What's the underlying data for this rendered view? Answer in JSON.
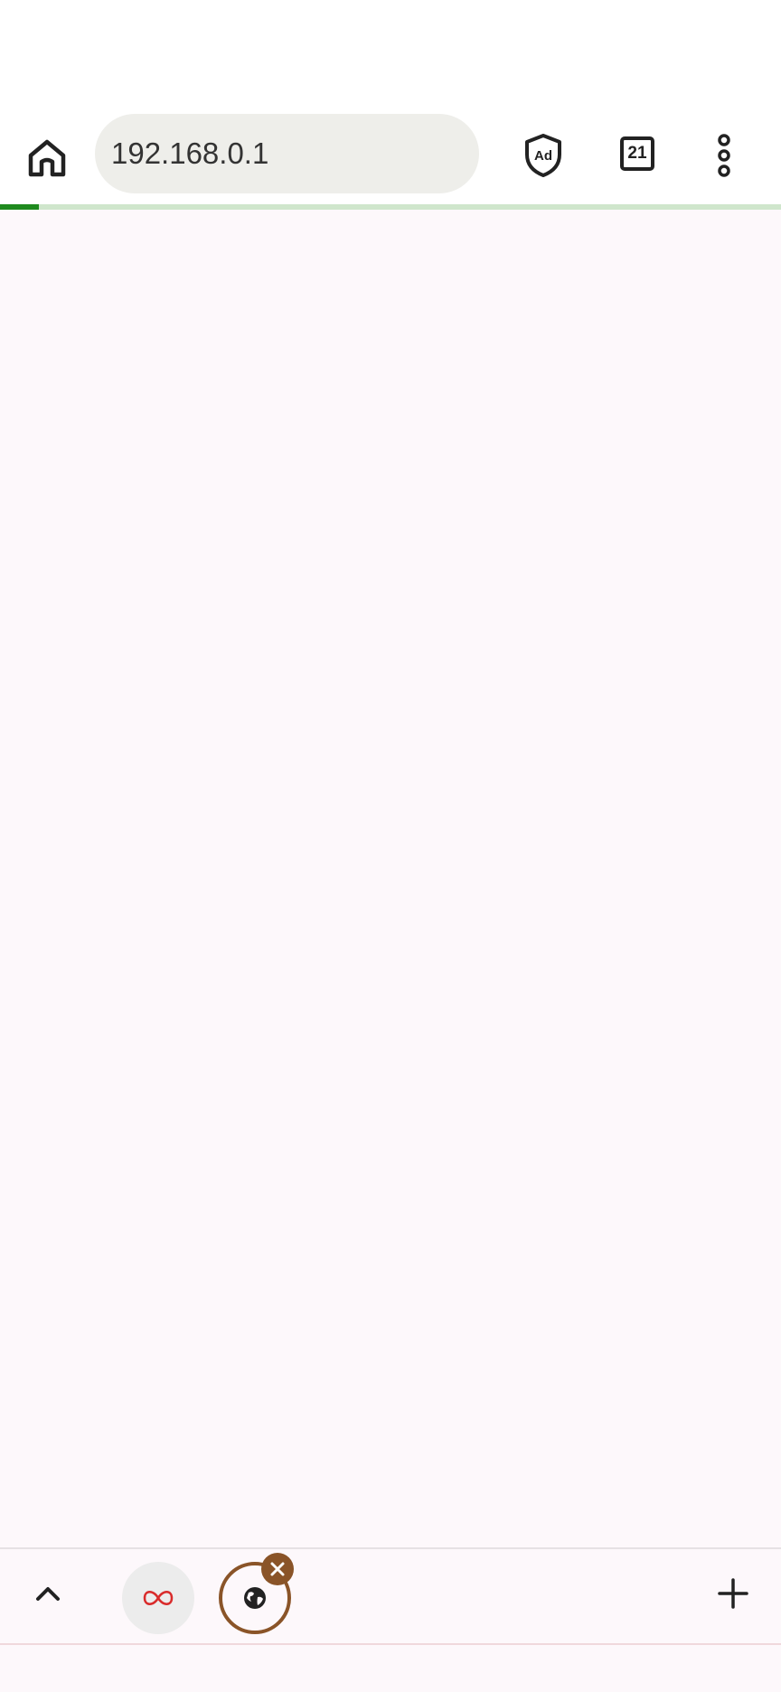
{
  "toolbar": {
    "url": "192.168.0.1",
    "tab_count": "21",
    "home_icon": "home-icon",
    "adblock_icon": "ad-shield-icon",
    "menu_icon": "more-vertical-icon"
  },
  "page_load": {
    "progress_percent": 5,
    "color": "#1e8a1e",
    "track_color": "#cfe6cc"
  },
  "tab_strip": {
    "expand_icon": "chevron-up-icon",
    "tabs": [
      {
        "icon": "infinity-icon",
        "active": false
      },
      {
        "icon": "globe-icon",
        "active": true
      }
    ],
    "close_icon": "close-icon",
    "add_icon": "plus-icon",
    "accent_color": "#8a5428"
  }
}
